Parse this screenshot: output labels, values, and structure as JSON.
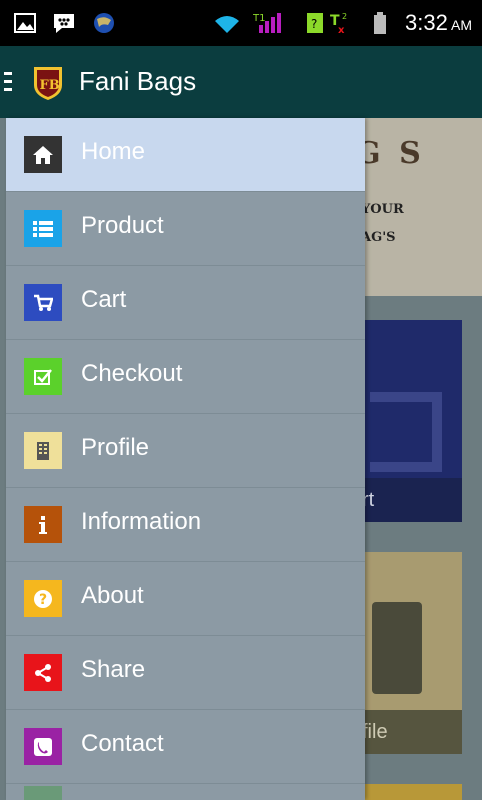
{
  "status_bar": {
    "time": "3:32",
    "ampm": "AM"
  },
  "app_bar": {
    "title": "Fani Bags",
    "logo_text": "FB"
  },
  "background": {
    "banner_line1": "G S",
    "banner_line2": "YOUR",
    "banner_line3": "AG'S",
    "card_cart_caption": "rt",
    "card_profile_caption": "file"
  },
  "drawer": {
    "items": [
      {
        "label": "Home",
        "icon": "home-icon",
        "color": "#333333"
      },
      {
        "label": "Product",
        "icon": "list-icon",
        "color": "#1aa3e8"
      },
      {
        "label": "Cart",
        "icon": "cart-icon",
        "color": "#2d4cc0"
      },
      {
        "label": "Checkout",
        "icon": "checkbox-icon",
        "color": "#5bd12b"
      },
      {
        "label": "Profile",
        "icon": "building-icon",
        "color": "#efe09a"
      },
      {
        "label": "Information",
        "icon": "info-icon",
        "color": "#b5520a"
      },
      {
        "label": "About",
        "icon": "question-icon",
        "color": "#f5b71e"
      },
      {
        "label": "Share",
        "icon": "share-icon",
        "color": "#e8141a"
      },
      {
        "label": "Contact",
        "icon": "phone-icon",
        "color": "#9a22a4"
      }
    ]
  }
}
